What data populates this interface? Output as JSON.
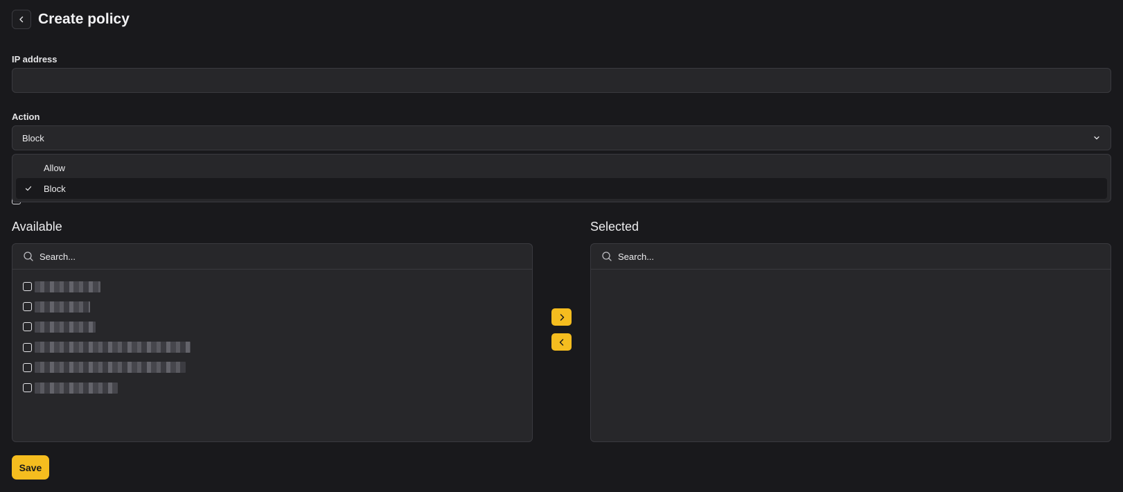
{
  "header": {
    "title": "Create policy"
  },
  "ip_field": {
    "label": "IP address",
    "value": "",
    "placeholder": ""
  },
  "action_field": {
    "label": "Action",
    "selected": "Block",
    "options": [
      {
        "label": "Allow",
        "selected": false
      },
      {
        "label": "Block",
        "selected": true
      }
    ]
  },
  "available": {
    "title": "Available",
    "search_placeholder": "Search...",
    "item_count": 6
  },
  "selected_panel": {
    "title": "Selected",
    "search_placeholder": "Search..."
  },
  "save_label": "Save",
  "colors": {
    "accent": "#f5bd1f",
    "background": "#19191c",
    "surface": "#27272a"
  }
}
